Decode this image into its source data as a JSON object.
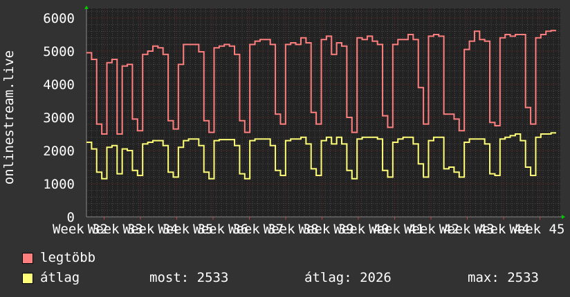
{
  "chart_data": {
    "type": "line",
    "ylabel": "onlinestream.live",
    "ylim": [
      0,
      6000
    ],
    "yticks": [
      0,
      1000,
      2000,
      3000,
      4000,
      5000,
      6000
    ],
    "xtick_labels": [
      "Week 32",
      "Week 33",
      "Week 34",
      "Week 35",
      "Week 36",
      "Week 37",
      "Week 38",
      "Week 39",
      "Week 40",
      "Week 41",
      "Week 42",
      "Week 43",
      "Week 44",
      "Week 45"
    ],
    "grid": true,
    "legend_placement": "bottom-left",
    "series": [
      {
        "name": "legtöbb",
        "color": "#ff7f7f",
        "values": [
          4950,
          4750,
          2800,
          2500,
          4650,
          4750,
          2500,
          4550,
          4600,
          2950,
          2600,
          4900,
          5000,
          5150,
          5100,
          4900,
          2900,
          2650,
          4600,
          5200,
          5200,
          5200,
          4980,
          2900,
          2550,
          5100,
          5150,
          5200,
          5150,
          4900,
          2900,
          2550,
          5200,
          5300,
          5350,
          5350,
          5200,
          3100,
          2800,
          5200,
          5250,
          5200,
          5400,
          5250,
          3150,
          2800,
          5350,
          5450,
          4900,
          5250,
          5150,
          3000,
          2550,
          5400,
          5350,
          5450,
          5300,
          5200,
          3050,
          2700,
          5200,
          5350,
          5350,
          5500,
          5350,
          3900,
          2800,
          5450,
          5500,
          5450,
          3100,
          3100,
          2950,
          2600,
          5050,
          5300,
          5600,
          5350,
          5300,
          2850,
          2750,
          5400,
          5500,
          5450,
          5500,
          5500,
          3300,
          2800,
          5400,
          5500,
          5600,
          5620
        ]
      },
      {
        "name": "átlag",
        "color": "#ffff77",
        "values": [
          2250,
          2050,
          1350,
          1150,
          2100,
          2150,
          1300,
          2050,
          2000,
          1400,
          1250,
          2200,
          2250,
          2300,
          2300,
          2150,
          1350,
          1200,
          2100,
          2300,
          2350,
          2350,
          2150,
          1350,
          1150,
          2300,
          2330,
          2330,
          2330,
          2150,
          1300,
          1150,
          2300,
          2350,
          2350,
          2350,
          2150,
          1400,
          1250,
          2300,
          2350,
          2350,
          2400,
          2200,
          1450,
          1250,
          2300,
          2400,
          2200,
          2400,
          2200,
          1400,
          1150,
          2350,
          2400,
          2400,
          2400,
          2350,
          1400,
          1200,
          2250,
          2350,
          2400,
          2400,
          2200,
          1600,
          1200,
          2300,
          2400,
          2400,
          1450,
          1500,
          1350,
          1200,
          2250,
          2350,
          2350,
          2350,
          2200,
          1300,
          1250,
          2350,
          2400,
          2450,
          2500,
          2300,
          1500,
          1250,
          2400,
          2500,
          2500,
          2533
        ]
      }
    ]
  },
  "legend": {
    "items": [
      {
        "label": "legtöbb",
        "color": "#ff7f7f"
      },
      {
        "label": "átlag",
        "color": "#ffff77"
      }
    ],
    "stats": {
      "now": "most: 2533",
      "avg": "átlag: 2026",
      "max": "max: 2533"
    }
  }
}
